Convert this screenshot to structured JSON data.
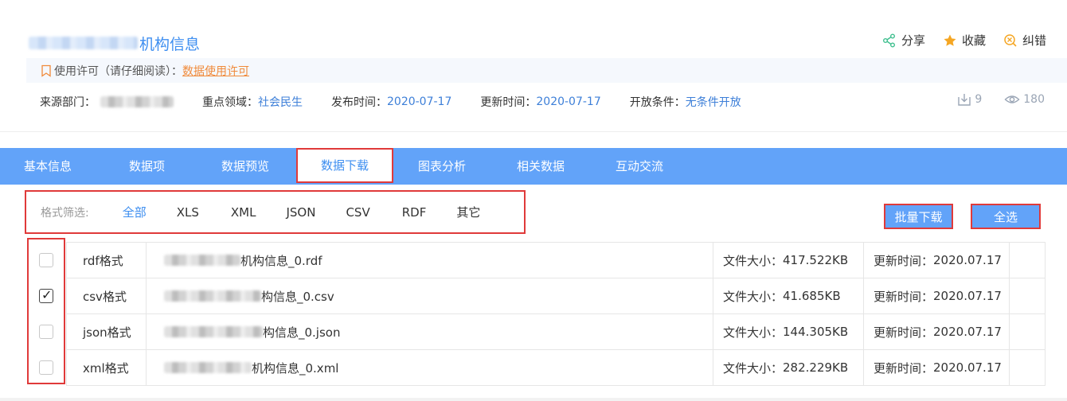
{
  "header": {
    "title": "机构信息",
    "actions": [
      {
        "label": "分享",
        "icon": "share-icon"
      },
      {
        "label": "收藏",
        "icon": "star-icon"
      },
      {
        "label": "纠错",
        "icon": "correct-icon"
      }
    ]
  },
  "license": {
    "label": "使用许可（请仔细阅读）：",
    "link": "数据使用许可"
  },
  "meta": {
    "source_label": "来源部门：",
    "domain_label": "重点领域：",
    "domain_value": "社会民生",
    "publish_label": "发布时间：",
    "publish_value": "2020-07-17",
    "update_label": "更新时间：",
    "update_value": "2020-07-17",
    "open_label": "开放条件：",
    "open_value": "无条件开放"
  },
  "stats": {
    "downloads": "9",
    "views": "180"
  },
  "tabs": [
    "基本信息",
    "数据项",
    "数据预览",
    "数据下载",
    "图表分析",
    "相关数据",
    "互动交流"
  ],
  "filters": {
    "label": "格式筛选:",
    "options": [
      "全部",
      "XLS",
      "XML",
      "JSON",
      "CSV",
      "RDF",
      "其它"
    ]
  },
  "buttons": {
    "batch_download": "批量下载",
    "select_all": "全选"
  },
  "files": [
    {
      "format": "rdf格式",
      "name": "机构信息_0.rdf",
      "size_label": "文件大小：",
      "size": "417.522KB",
      "date_label": "更新时间：",
      "date": "2020.07.17",
      "checked": false
    },
    {
      "format": "csv格式",
      "name": "构信息_0.csv",
      "size_label": "文件大小：",
      "size": "41.685KB",
      "date_label": "更新时间：",
      "date": "2020.07.17",
      "checked": true
    },
    {
      "format": "json格式",
      "name": "构信息_0.json",
      "size_label": "文件大小：",
      "size": "144.305KB",
      "date_label": "更新时间：",
      "date": "2020.07.17",
      "checked": false
    },
    {
      "format": "xml格式",
      "name": "机构信息_0.xml",
      "size_label": "文件大小：",
      "size": "282.229KB",
      "date_label": "更新时间：",
      "date": "2020.07.17",
      "checked": false
    }
  ],
  "colors": {
    "accent": "#3d8ef0",
    "tabbar": "#62a3f9",
    "highlight": "#e03a3a",
    "link_orange": "#f08a3a"
  }
}
